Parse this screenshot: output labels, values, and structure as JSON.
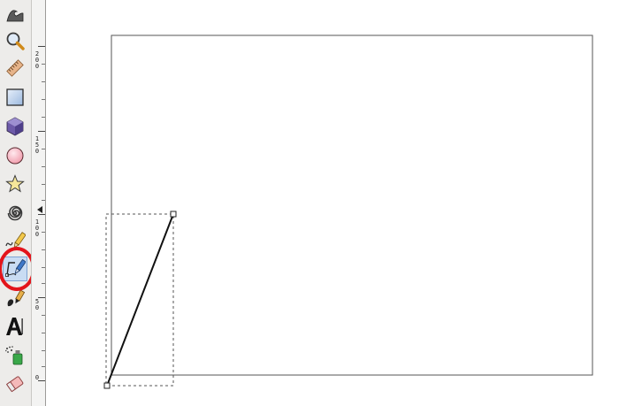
{
  "toolbox": {
    "tools": [
      {
        "name": "tweak-tool",
        "icon": "wave-icon",
        "active": false
      },
      {
        "name": "zoom-tool",
        "icon": "magnifier-icon",
        "active": false
      },
      {
        "name": "measure-tool",
        "icon": "ruler-icon",
        "active": false
      },
      {
        "name": "rectangle-tool",
        "icon": "square-icon",
        "active": false
      },
      {
        "name": "box-3d-tool",
        "icon": "cube-icon",
        "active": false
      },
      {
        "name": "ellipse-tool",
        "icon": "circle-icon",
        "active": false
      },
      {
        "name": "star-tool",
        "icon": "star-icon",
        "active": false
      },
      {
        "name": "spiral-tool",
        "icon": "spiral-icon",
        "active": false
      },
      {
        "name": "pencil-tool",
        "icon": "pencil-icon",
        "active": false
      },
      {
        "name": "pen-tool",
        "icon": "bezier-pen-icon",
        "active": true
      },
      {
        "name": "calligraphy-tool",
        "icon": "calligraphy-icon",
        "active": false
      },
      {
        "name": "text-tool",
        "icon": "text-a-icon",
        "active": false
      },
      {
        "name": "spray-tool",
        "icon": "spray-can-icon",
        "active": false
      },
      {
        "name": "eraser-tool",
        "icon": "eraser-icon",
        "active": false
      }
    ]
  },
  "ruler": {
    "labels": [
      "200",
      "150",
      "100",
      "50",
      "0"
    ]
  },
  "colors": {
    "toolbox_bg": "#edecea",
    "active_tool_bg": "#c9dcf3",
    "highlight_ring": "#e3141b",
    "page_border": "#555555",
    "path_stroke": "#111111"
  }
}
